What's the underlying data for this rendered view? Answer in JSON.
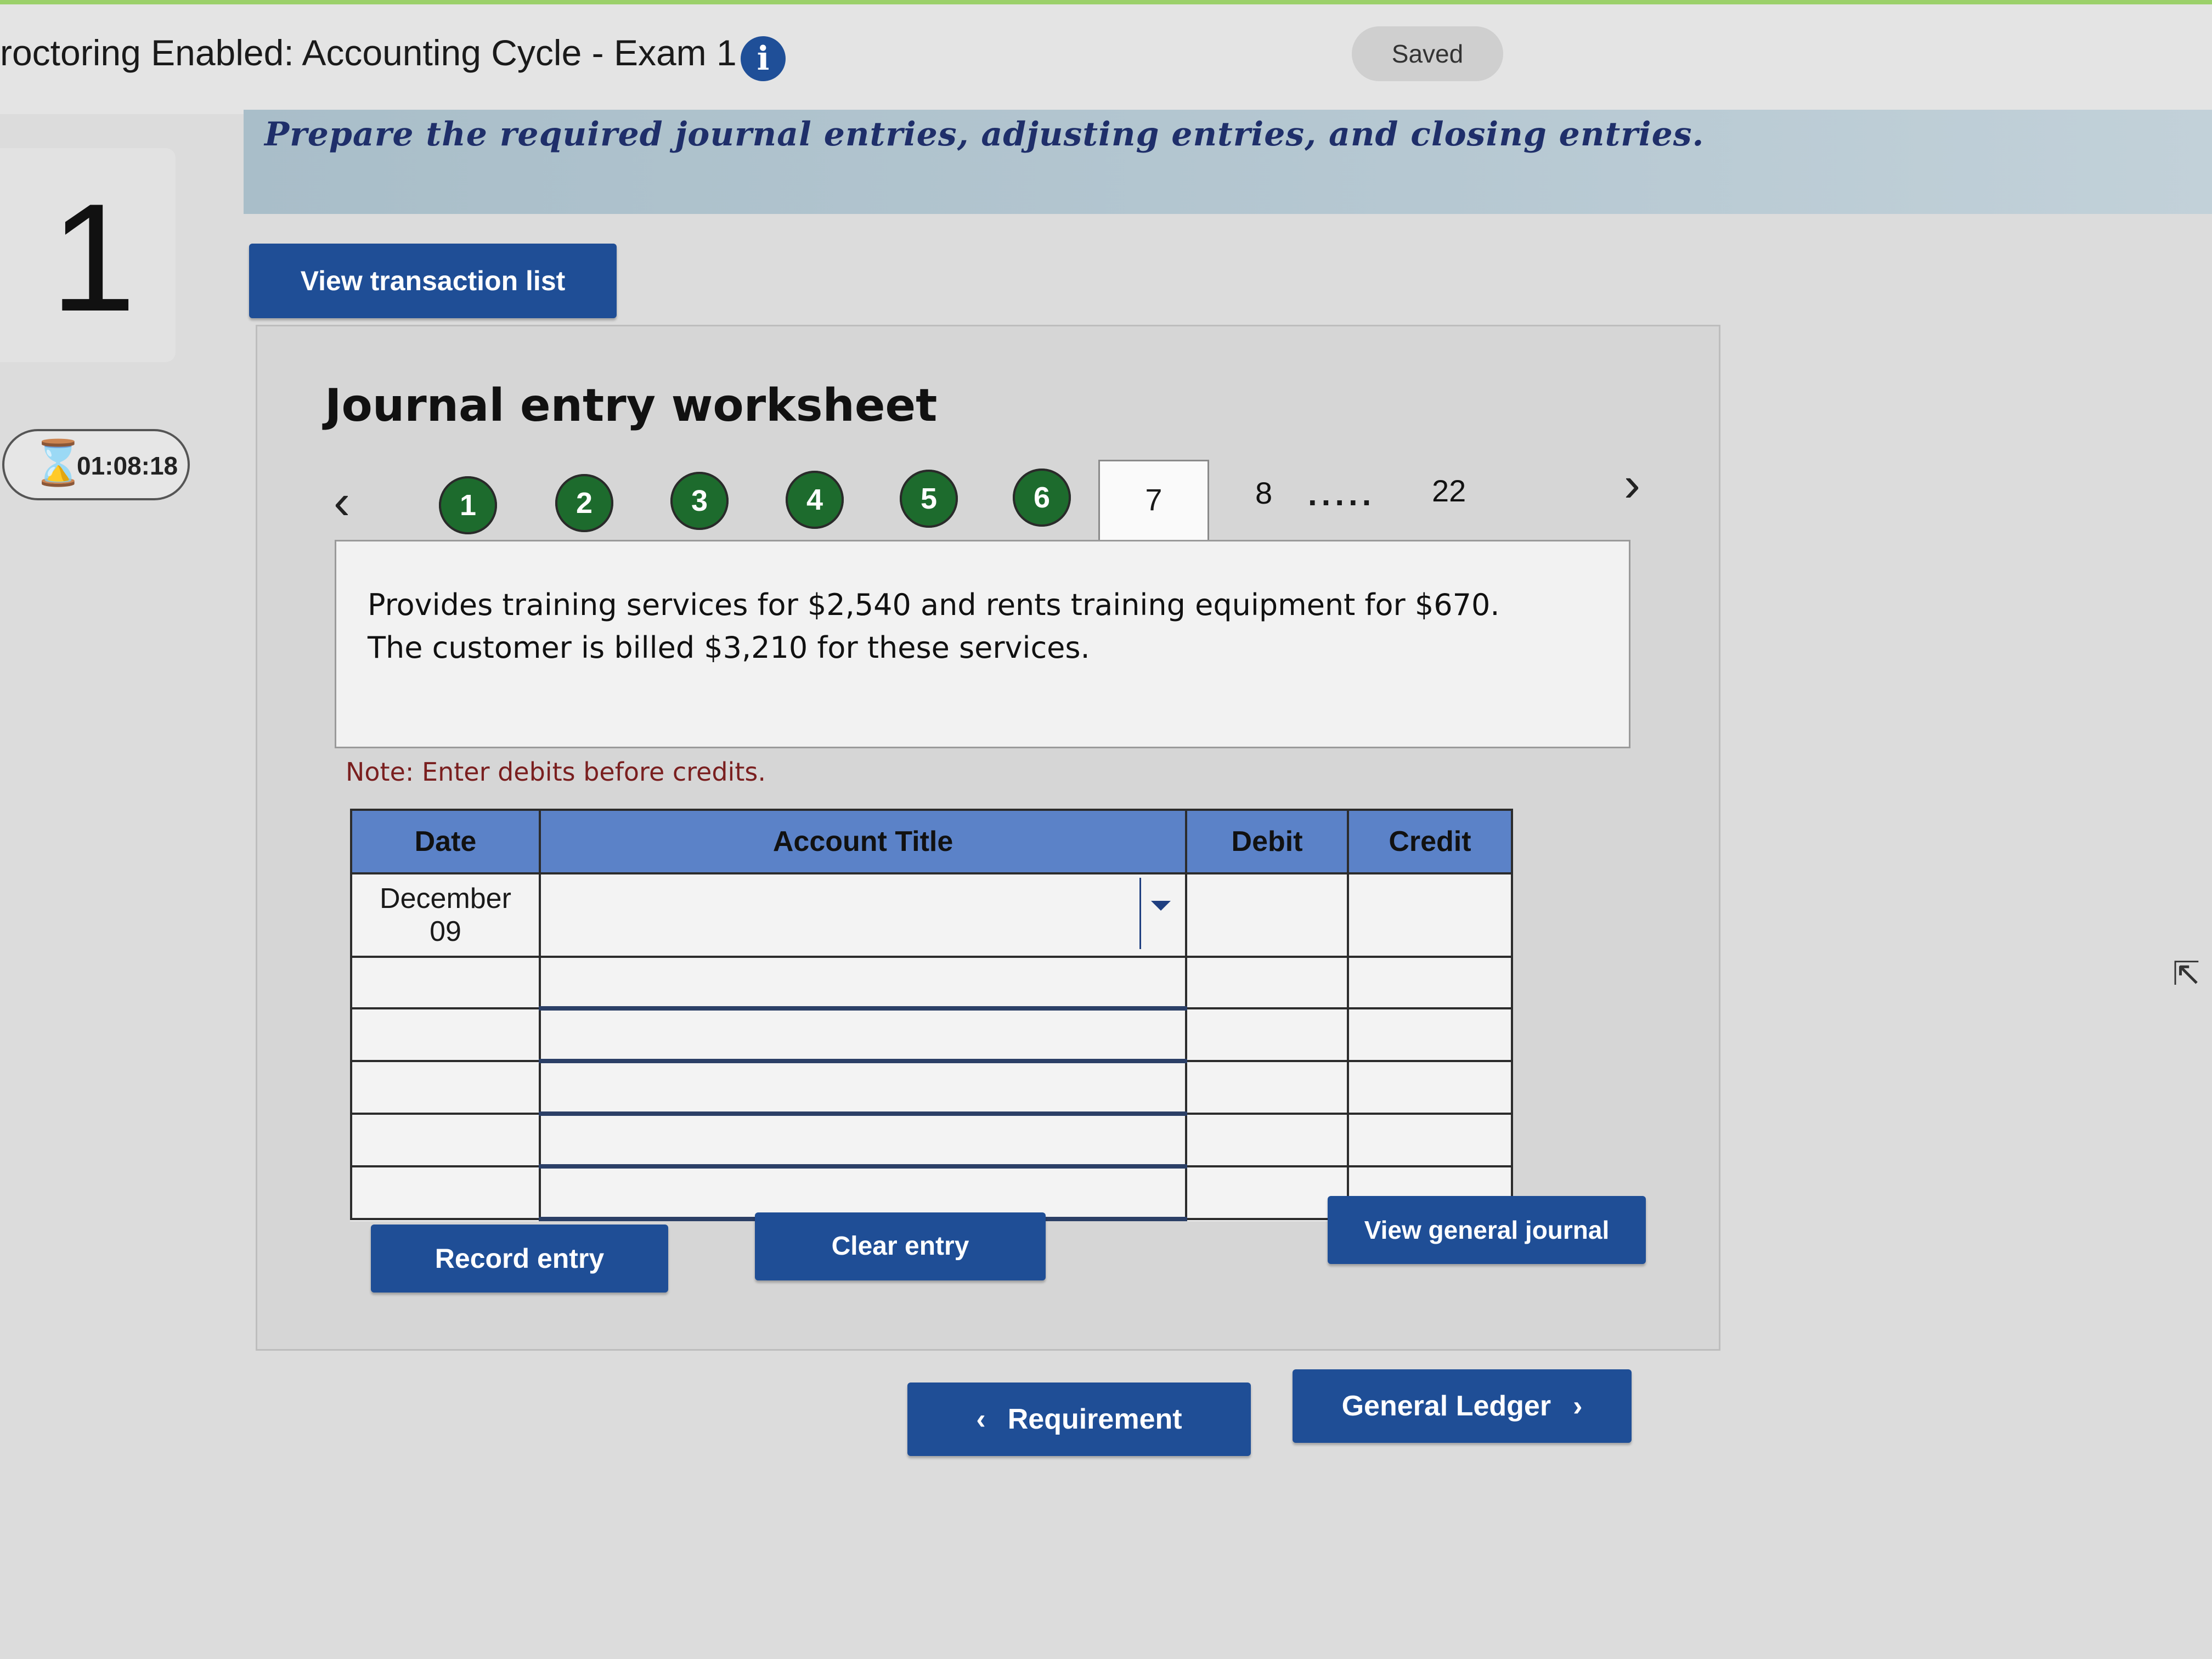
{
  "header": {
    "title": "roctoring Enabled: Accounting Cycle - Exam 1",
    "info_icon": "info-icon",
    "saved_label": "Saved"
  },
  "instruction": "Prepare the required journal entries, adjusting entries, and closing entries.",
  "question_number": "1",
  "timer": {
    "icon": "hourglass-icon",
    "value": "01:08:18"
  },
  "view_transaction_list_label": "View transaction list",
  "worksheet": {
    "title": "Journal entry worksheet",
    "prev_icon": "chevron-left-icon",
    "next_icon": "chevron-right-icon",
    "completed_steps": [
      "1",
      "2",
      "3",
      "4",
      "5",
      "6"
    ],
    "active_step": "7",
    "next_step": "8",
    "ellipsis": ".....",
    "last_step": "22",
    "description_line1": "Provides training services for $2,540 and rents training equipment for $670.",
    "description_line2": "The customer is billed $3,210 for these services.",
    "note": "Note: Enter debits before credits.",
    "table": {
      "headers": {
        "date": "Date",
        "account": "Account Title",
        "debit": "Debit",
        "credit": "Credit"
      },
      "first_row_date_line1": "December",
      "first_row_date_line2": "09",
      "dropdown_icon": "caret-down-icon"
    },
    "record_entry_label": "Record entry",
    "clear_entry_label": "Clear entry",
    "view_general_journal_label": "View general journal"
  },
  "footer_nav": {
    "requirement_label": "Requirement",
    "general_ledger_label": "General Ledger"
  },
  "colors": {
    "button_blue": "#1f4e96",
    "step_green": "#1d6b2d",
    "table_header": "#5b82c8",
    "instruction_bar": "#b6c8d2"
  }
}
